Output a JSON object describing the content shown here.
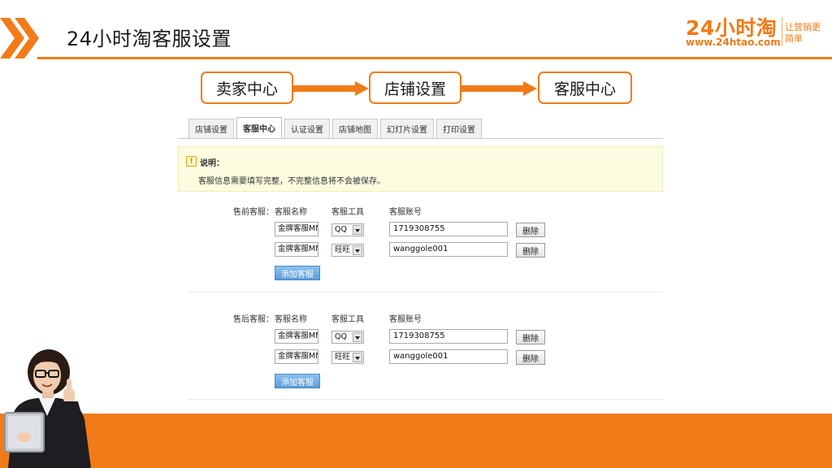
{
  "slide": {
    "title": "24小时淘客服设置",
    "accent_color": "#f07b18"
  },
  "logo": {
    "main": "24小时淘",
    "url": "www.24htao.com",
    "slogan": "让营销更简单"
  },
  "flow": [
    "卖家中心",
    "店铺设置",
    "客服中心"
  ],
  "tabs": [
    {
      "label": "店铺设置",
      "active": false
    },
    {
      "label": "客服中心",
      "active": true
    },
    {
      "label": "认证设置",
      "active": false
    },
    {
      "label": "店铺地图",
      "active": false
    },
    {
      "label": "幻灯片设置",
      "active": false
    },
    {
      "label": "打印设置",
      "active": false
    }
  ],
  "notice": {
    "icon": "!",
    "title": "说明：",
    "text": "客服信息需要填写完整，不完整信息将不会被保存。"
  },
  "columns": {
    "name": "客服名称",
    "tool": "客服工具",
    "account": "客服账号"
  },
  "presale": {
    "label": "售前客服：",
    "rows": [
      {
        "name": "金牌客服MM",
        "tool": "QQ",
        "account": "1719308755",
        "delete": "删除"
      },
      {
        "name": "金牌客服MM",
        "tool": "旺旺",
        "account": "wanggole001",
        "delete": "删除"
      }
    ],
    "add": "添加客服"
  },
  "aftersale": {
    "label": "售后客服：",
    "rows": [
      {
        "name": "金牌客服MM",
        "tool": "QQ",
        "account": "1719308755",
        "delete": "删除"
      },
      {
        "name": "金牌客服MM",
        "tool": "旺旺",
        "account": "wanggole001",
        "delete": "删除"
      }
    ],
    "add": "添加客服"
  }
}
